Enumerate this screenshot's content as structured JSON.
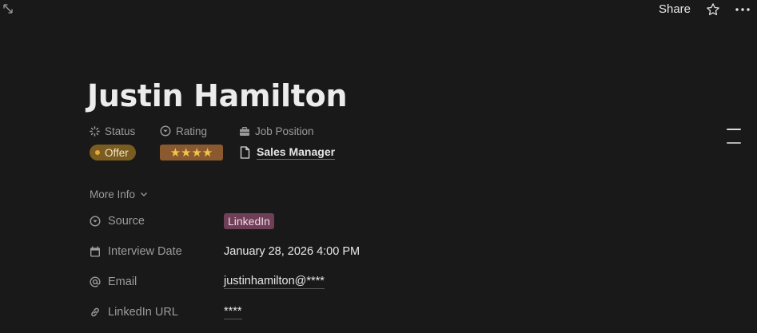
{
  "topbar": {
    "expand_icon": "expand-arrows-icon",
    "share_label": "Share",
    "favorite_icon": "star-outline-icon",
    "more_icon": "ellipsis-icon"
  },
  "page": {
    "title": "Justin Hamilton"
  },
  "properties": {
    "status": {
      "label": "Status",
      "icon": "status-spinner-icon",
      "value": "Offer",
      "color": "#7a5c20",
      "dot_color": "#e6a63a"
    },
    "rating": {
      "label": "Rating",
      "icon": "chevron-circle-icon",
      "value": "★★★★",
      "stars": 4,
      "color": "#8a5a2e"
    },
    "job_position": {
      "label": "Job Position",
      "icon": "briefcase-icon",
      "value": "Sales Manager",
      "value_icon": "page-icon"
    }
  },
  "more_info": {
    "label": "More Info",
    "icon": "chevron-down-icon",
    "rows": {
      "source": {
        "label": "Source",
        "icon": "chevron-circle-icon",
        "value": "LinkedIn",
        "tag_color": "#6f3e57"
      },
      "interview_date": {
        "label": "Interview Date",
        "icon": "calendar-icon",
        "value": "January 28, 2026 4:00 PM"
      },
      "email": {
        "label": "Email",
        "icon": "at-sign-icon",
        "value": "justinhamilton@****"
      },
      "linkedin_url": {
        "label": "LinkedIn URL",
        "icon": "link-icon",
        "value": "****"
      }
    }
  },
  "outline_toggle": {
    "icon": "outline-lines-icon"
  }
}
